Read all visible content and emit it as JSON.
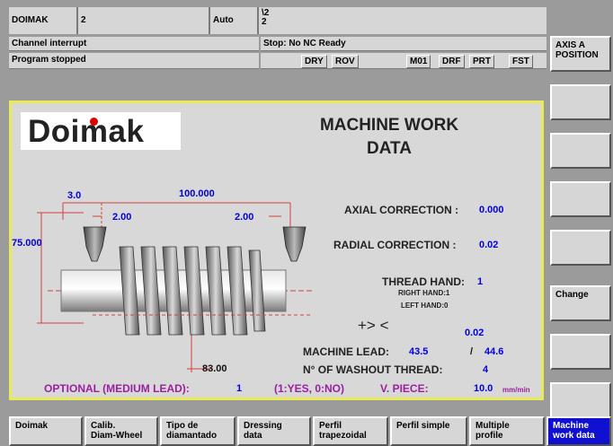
{
  "header": {
    "machine": "DOIMAK",
    "channel_no": "2",
    "mode": "Auto",
    "program_path_1": "\\2",
    "program_path_2": "2"
  },
  "status": {
    "channel": "Channel interrupt",
    "program": "Program stopped",
    "stop_message": "Stop: No NC Ready",
    "flags": [
      "DRY",
      "ROV",
      "M01",
      "DRF",
      "PRT",
      "FST"
    ]
  },
  "vertical_softkeys": {
    "k1": "AXIS A\nPOSITION",
    "k2": "",
    "k3": "",
    "k4": "",
    "k5": "",
    "k6": "Change",
    "k7": "",
    "k8": ""
  },
  "horizontal_softkeys": [
    {
      "label": "Doimak"
    },
    {
      "label": "Calib.\nDiam-Wheel"
    },
    {
      "label": "Tipo de\ndiamantado"
    },
    {
      "label": "Dressing\ndata"
    },
    {
      "label": "Perfil\ntrapezoidal"
    },
    {
      "label": "Perfil simple"
    },
    {
      "label": "Multiple\nprofile"
    },
    {
      "label": "Machine\nwork data"
    }
  ],
  "panel": {
    "logo": "Doimak",
    "title_line1": "MACHINE WORK",
    "title_line2": "DATA",
    "axial_label": "AXIAL CORRECTION :",
    "axial_value": "0.000",
    "radial_label": "RADIAL CORRECTION :",
    "radial_value": "0.02",
    "thread_hand_label": "THREAD HAND:",
    "thread_hand_value": "1",
    "right_hand": "RIGHT HAND:1",
    "left_hand": "LEFT HAND:0",
    "angle_symbols": "+>  <",
    "angle_value": "0.02",
    "machine_lead_label": "MACHINE LEAD:",
    "machine_lead_value": "43.5",
    "machine_lead_sep": "/",
    "machine_lead_value2": "44.6",
    "washout_label": "N° OF WASHOUT THREAD:",
    "washout_value": "4",
    "optional_label": "OPTIONAL (MEDIUM LEAD):",
    "optional_value": "1",
    "optional_hint": "(1:YES, 0:NO)",
    "vpiece_label": "V. PIECE:",
    "vpiece_value": "10.0",
    "vpiece_unit": "mm/min",
    "dim_3": "3.0",
    "dim_100": "100.000",
    "dim_2a": "2.00",
    "dim_2b": "2.00",
    "dim_75": "75.000",
    "dim_83": "83.00"
  },
  "colors": {
    "background": "#9b9b9b",
    "panel": "#d8d8d8",
    "panel_border": "#eaea55",
    "value_blue": "#0000e0",
    "softkey_active": "#1010d0",
    "optional_purple": "#9a1fa0",
    "logo_dot": "#e00000"
  }
}
